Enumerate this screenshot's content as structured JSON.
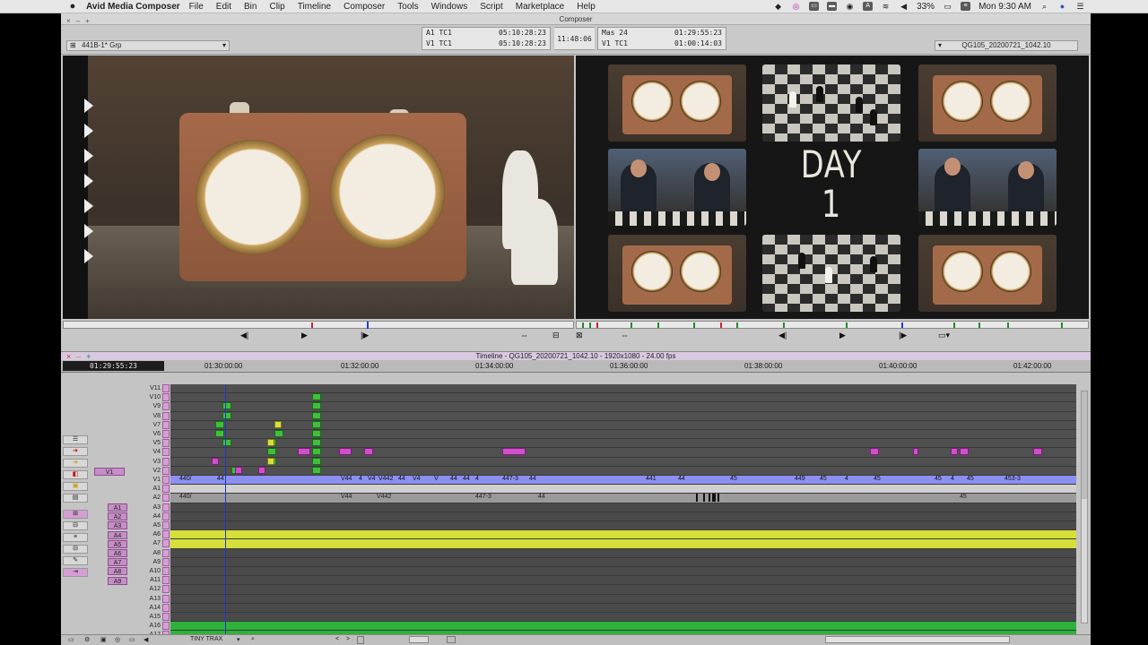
{
  "menubar": {
    "apple": "",
    "app": "Avid Media Composer",
    "items": [
      "File",
      "Edit",
      "Bin",
      "Clip",
      "Timeline",
      "Composer",
      "Tools",
      "Windows",
      "Script",
      "Marketplace",
      "Help"
    ],
    "battery": "33%",
    "clock": "Mon 9:30 AM"
  },
  "composer": {
    "title": "Composer",
    "group_label": "441B-1* Grp",
    "left_tc": {
      "row1_label": "A1 TC1",
      "row1_value": "05:10:28:23",
      "row2_label": "V1 TC1",
      "row2_value": "05:10:28:23"
    },
    "center_tc": "11:48:06",
    "right_tc": {
      "row1_label": "Mas 24",
      "row1_value": "01:29:55:23",
      "row2_label": "V1 TC1",
      "row2_value": "01:00:14:03"
    },
    "sequence_name": "QG105_20200721_1042.10",
    "record_title": [
      "DAY",
      "1"
    ]
  },
  "timeline": {
    "title": "Timeline - QG105_20200721_1042.10 - 1920x1080 - 24.00 fps",
    "position_tc": "01:29:55:23",
    "ruler": [
      "01:30:00:00",
      "01:32:00:00",
      "01:34:00:00",
      "01:36:00:00",
      "01:38:00:00",
      "01:40:00:00",
      "01:42:00:00"
    ],
    "video_tracks": [
      "V11",
      "V10",
      "V9",
      "V8",
      "V7",
      "V6",
      "V5",
      "V4",
      "V3",
      "V2",
      "V1"
    ],
    "timecode_track": "A1",
    "audio_tracks": [
      "A2",
      "A3",
      "A4",
      "A5",
      "A6",
      "A7",
      "A8",
      "A9",
      "A10",
      "A11",
      "A12",
      "A13",
      "A14",
      "A15",
      "A16",
      "A17"
    ],
    "source_patches": [
      "V1",
      "A1",
      "A2",
      "A3",
      "A4",
      "A5",
      "A6",
      "A7",
      "A8",
      "A9"
    ],
    "v1_clip_labels": [
      "440/",
      "44",
      "V44",
      "4",
      "V4",
      "V442",
      "44",
      "V4",
      "V",
      "44",
      "44",
      "4",
      "447-3",
      "44",
      "441",
      "44",
      "45",
      "449",
      "45",
      "4",
      "45",
      "45",
      "4",
      "45",
      "453-3"
    ],
    "a1_clip_labels": [
      "440/",
      "V44",
      "V442",
      "447-3",
      "44",
      "45"
    ],
    "track_size_label": "TINY TRAX",
    "colors": {
      "video_clip": "#8b8ff0",
      "audio_yellow": "#d5df3a",
      "audio_green": "#2fb23b",
      "effect_pink": "#d04fcc",
      "effect_green": "#3fbf3c",
      "playhead": "#2233cc"
    }
  }
}
